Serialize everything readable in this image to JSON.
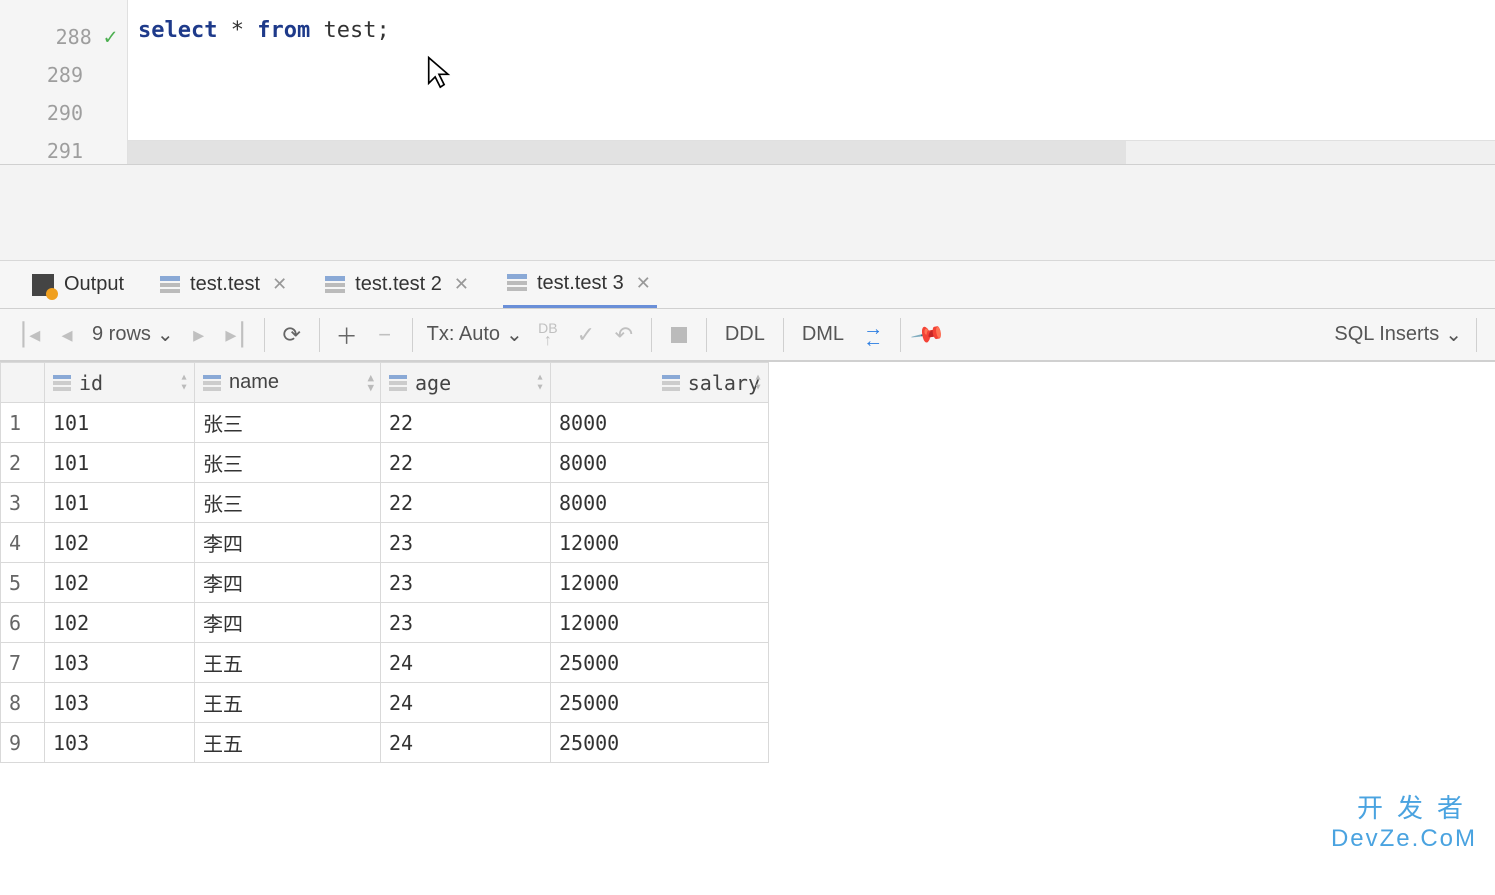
{
  "editor": {
    "lines": [
      "288",
      "289",
      "290",
      "291"
    ],
    "has_check_on_first": true,
    "sql_kw1": "select",
    "sql_star": " * ",
    "sql_kw2": "from",
    "sql_tbl": " test",
    "sql_end": ";"
  },
  "tabs": {
    "output": "Output",
    "t1": "test.test",
    "t2": "test.test 2",
    "t3": "test.test 3"
  },
  "toolbar": {
    "rows_label": "9 rows",
    "tx_label": "Tx: Auto",
    "ddl": "DDL",
    "dml": "DML",
    "sql_inserts": "SQL Inserts"
  },
  "grid": {
    "columns": [
      "id",
      "name",
      "age",
      "salary"
    ],
    "rows": [
      {
        "n": "1",
        "id": "101",
        "name": "张三",
        "age": "22",
        "salary": "8000"
      },
      {
        "n": "2",
        "id": "101",
        "name": "张三",
        "age": "22",
        "salary": "8000"
      },
      {
        "n": "3",
        "id": "101",
        "name": "张三",
        "age": "22",
        "salary": "8000"
      },
      {
        "n": "4",
        "id": "102",
        "name": "李四",
        "age": "23",
        "salary": "12000"
      },
      {
        "n": "5",
        "id": "102",
        "name": "李四",
        "age": "23",
        "salary": "12000"
      },
      {
        "n": "6",
        "id": "102",
        "name": "李四",
        "age": "23",
        "salary": "12000"
      },
      {
        "n": "7",
        "id": "103",
        "name": "王五",
        "age": "24",
        "salary": "25000"
      },
      {
        "n": "8",
        "id": "103",
        "name": "王五",
        "age": "24",
        "salary": "25000"
      },
      {
        "n": "9",
        "id": "103",
        "name": "王五",
        "age": "24",
        "salary": "25000"
      }
    ]
  },
  "watermark": {
    "line1": "开发者",
    "line2": "DevZe.CoM"
  }
}
